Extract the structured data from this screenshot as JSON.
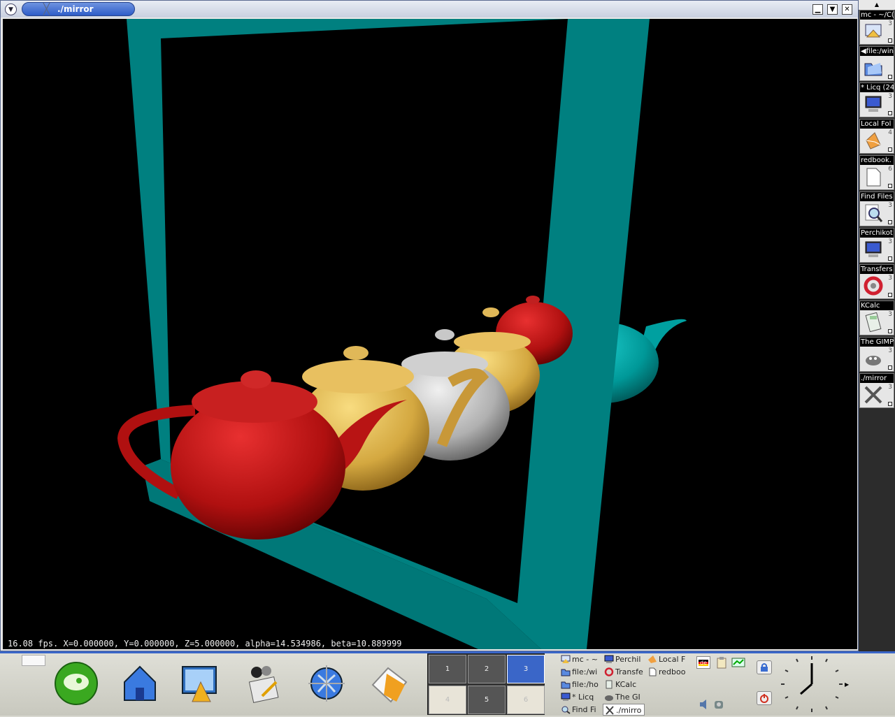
{
  "window": {
    "title": "./mirror",
    "title_icon": "x-window-icon",
    "buttons": [
      "minimize",
      "maximize",
      "close"
    ]
  },
  "viewport": {
    "status": "16.08 fps.  X=0.000000, Y=0.000000, Z=5.000000, alpha=14.534986, beta=10.889999",
    "colors": {
      "background": "#000000",
      "frame": "#008080",
      "teapot_red": "#b01010",
      "teapot_gold": "#d4a840",
      "teapot_silver": "#b8b8b8",
      "teapot_teal": "#00a0a0"
    }
  },
  "sidebar": {
    "items": [
      {
        "label": "mc - ~/C(",
        "num": "3",
        "icon": "shell-icon"
      },
      {
        "label": "◀file:/win",
        "num": "",
        "icon": "folder-icon"
      },
      {
        "label": "* Licq (24",
        "num": "3",
        "icon": "computer-icon"
      },
      {
        "label": "Local Fol",
        "num": "4",
        "icon": "mail-icon"
      },
      {
        "label": "redbook.",
        "num": "6",
        "icon": "document-icon"
      },
      {
        "label": "Find Files",
        "num": "3",
        "icon": "find-icon"
      },
      {
        "label": "Perchikot",
        "num": "3",
        "icon": "computer-icon"
      },
      {
        "label": "Transfers",
        "num": "3",
        "icon": "transfer-icon"
      },
      {
        "label": "KCalc",
        "num": "3",
        "icon": "calculator-icon"
      },
      {
        "label": "The GIMP",
        "num": "3",
        "icon": "gimp-icon"
      },
      {
        "label": "./mirror",
        "num": "3",
        "icon": "x-icon"
      }
    ]
  },
  "panel": {
    "launchers": [
      {
        "name": "suse-menu-icon"
      },
      {
        "name": "home-icon"
      },
      {
        "name": "control-center-icon"
      },
      {
        "name": "kmail-icon"
      },
      {
        "name": "konqueror-icon"
      },
      {
        "name": "kontact-icon"
      }
    ],
    "desktops": [
      "1",
      "2",
      "3",
      "4",
      "5",
      "6"
    ],
    "active_desktop": "3",
    "tasks": [
      {
        "label": "mc - ~",
        "icon": "shell-icon"
      },
      {
        "label": "Perchil",
        "icon": "computer-icon"
      },
      {
        "label": "Local F",
        "icon": "mail-icon"
      },
      {
        "label": "file:/wi",
        "icon": "folder-icon"
      },
      {
        "label": "Transfe",
        "icon": "transfer-icon"
      },
      {
        "label": "redboo",
        "icon": "document-icon"
      },
      {
        "label": "file:/ho",
        "icon": "folder-icon"
      },
      {
        "label": "KCalc",
        "icon": "calculator-icon"
      },
      {
        "label": "* Licq",
        "icon": "computer-icon"
      },
      {
        "label": "The GI",
        "icon": "gimp-icon"
      },
      {
        "label": "Find Fi",
        "icon": "find-icon"
      },
      {
        "label": "./mirro",
        "icon": "x-icon"
      }
    ],
    "tray": {
      "keyboard_layout": "de"
    }
  }
}
